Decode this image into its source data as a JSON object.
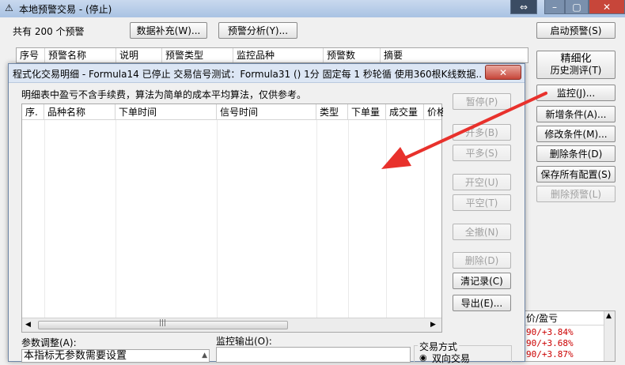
{
  "main_window": {
    "title": "本地预警交易 - (停止)",
    "count_text": "共有 200 个预警",
    "btn_data_fill": "数据补充(W)...",
    "btn_warn_analysis": "预警分析(Y)...",
    "btn_start_warning": "启动预警(S)",
    "columns": [
      "序号",
      "预警名称",
      "说明",
      "预警类型",
      "监控品种",
      "预警数",
      "摘要"
    ],
    "right_buttons": {
      "refine_line1": "精细化",
      "refine_line2": "历史测评(T)",
      "monitor": "监控(J)...",
      "add_condition": "新增条件(A)...",
      "modify_condition": "修改条件(M)...",
      "delete_condition": "删除条件(D)",
      "save_all": "保存所有配置(S)",
      "delete_warning": "删除预警(L)"
    },
    "bottom_panel": {
      "header": "价/盈亏",
      "lines": [
        "90/+3.84%",
        "90/+3.68%",
        "90/+3.87%"
      ]
    }
  },
  "dialog": {
    "title": "程式化交易明细 - Formula14 已停止  交易信号测试：Formula31 () 1分 固定每 1 秒轮循 使用360根K线数据...",
    "note": "明细表中盈亏不含手续费，算法为简单的成本平均算法，仅供参考。",
    "columns": [
      "序.",
      "品种名称",
      "下单时间",
      "信号时间",
      "类型",
      "下单量",
      "成交量",
      "价格"
    ],
    "buttons": {
      "pause": "暂停(P)",
      "open_long": "开多(B)",
      "close_long": "平多(S)",
      "open_short": "开空(U)",
      "close_short": "平空(T)",
      "cancel_all": "全撤(N)",
      "delete": "删除(D)",
      "clear_records": "清记录(C)",
      "export": "导出(E)..."
    },
    "param_label": "参数调整(A):",
    "param_value": "本指标无参数需要设置",
    "monitor_output_label": "监控输出(O):",
    "trade_mode_label": "交易方式",
    "trade_mode_option": "双向交易"
  },
  "colors": {
    "arrow": "#e8312c",
    "dialog_title_bg": "#dce6f4"
  }
}
